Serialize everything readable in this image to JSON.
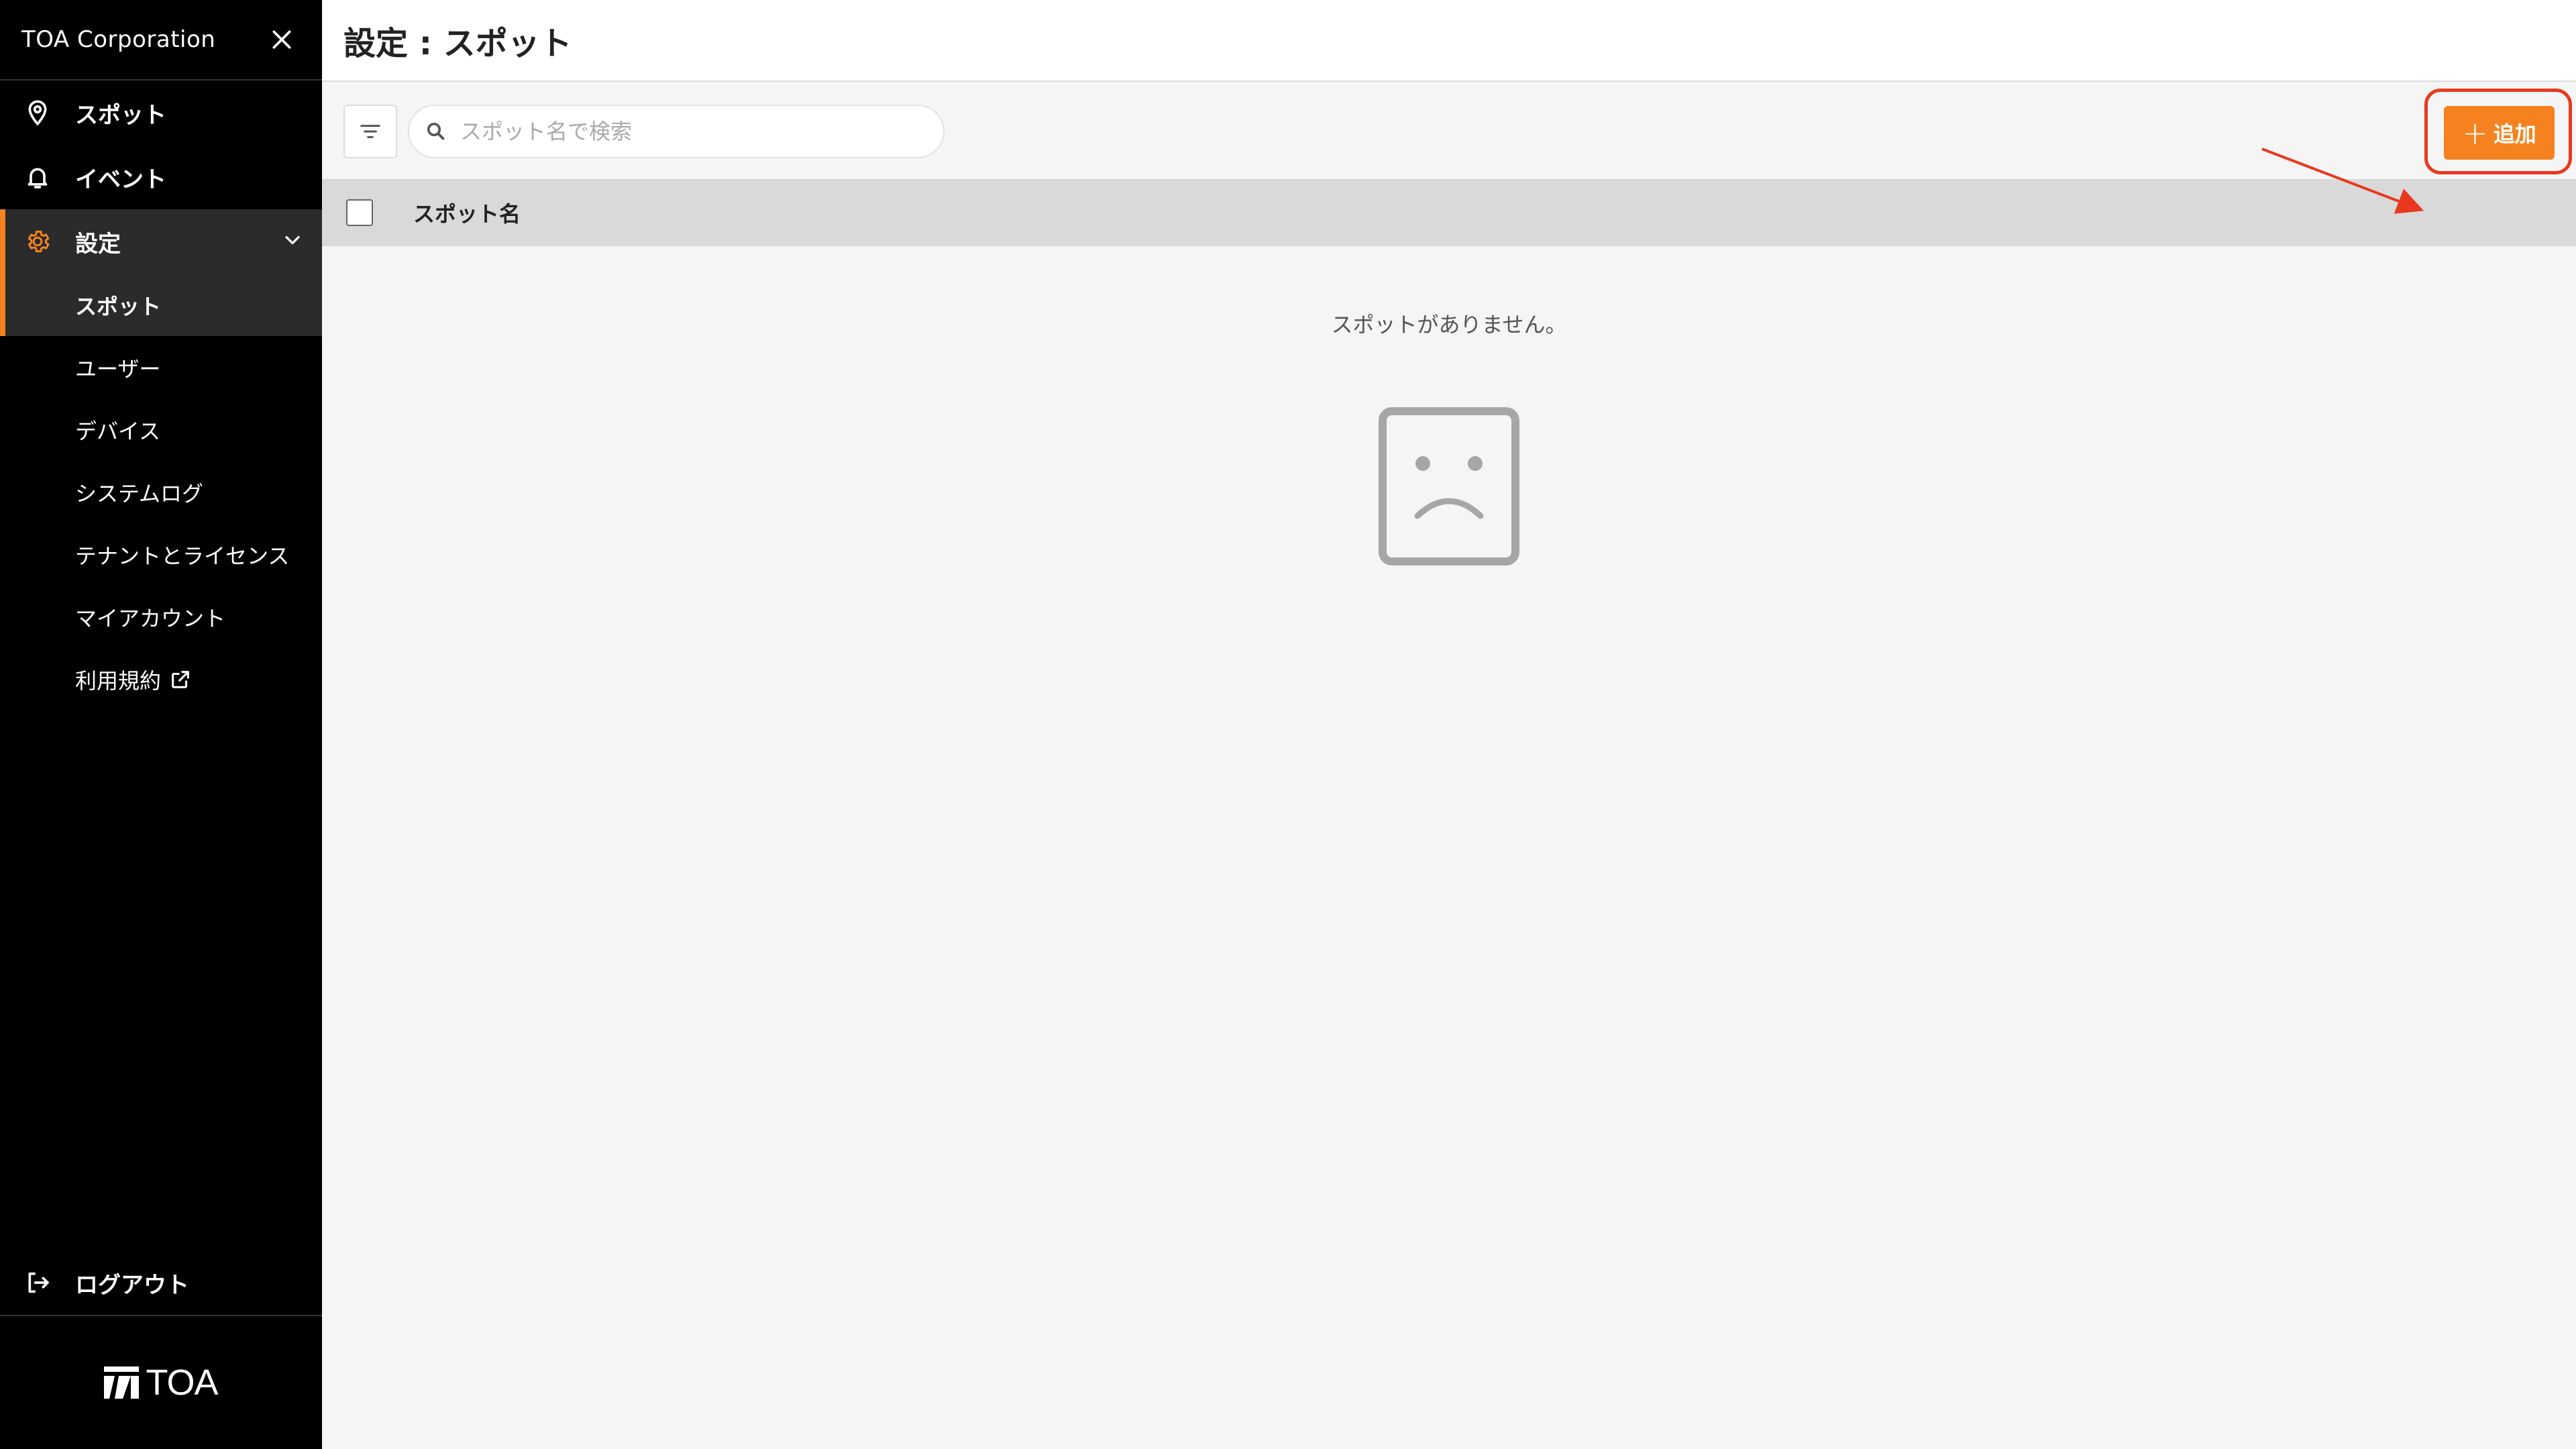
{
  "sidebar": {
    "company": "TOA Corporation",
    "nav": [
      {
        "label": "スポット",
        "icon": "location-pin-icon"
      },
      {
        "label": "イベント",
        "icon": "bell-icon"
      }
    ],
    "settings": {
      "label": "設定",
      "icon": "gear-icon",
      "expanded": true,
      "items": [
        {
          "label": "スポット",
          "active": true
        },
        {
          "label": "ユーザー"
        },
        {
          "label": "デバイス"
        },
        {
          "label": "システムログ"
        },
        {
          "label": "テナントとライセンス"
        },
        {
          "label": "マイアカウント"
        },
        {
          "label": "利用規約",
          "icon": "external-link-icon"
        }
      ]
    },
    "logout": {
      "label": "ログアウト",
      "icon": "logout-icon"
    },
    "logo_text": "TOA"
  },
  "header": {
    "title": "設定 : スポット"
  },
  "toolbar": {
    "search_placeholder": "スポット名で検索",
    "add_label": "追加"
  },
  "table": {
    "columns": [
      "スポット名"
    ],
    "rows": []
  },
  "empty_state": {
    "message": "スポットがありません。",
    "icon": "sad-face-icon"
  },
  "colors": {
    "accent": "#f5821f",
    "sidebar_bg": "#000000",
    "annotation": "#e8391f"
  }
}
